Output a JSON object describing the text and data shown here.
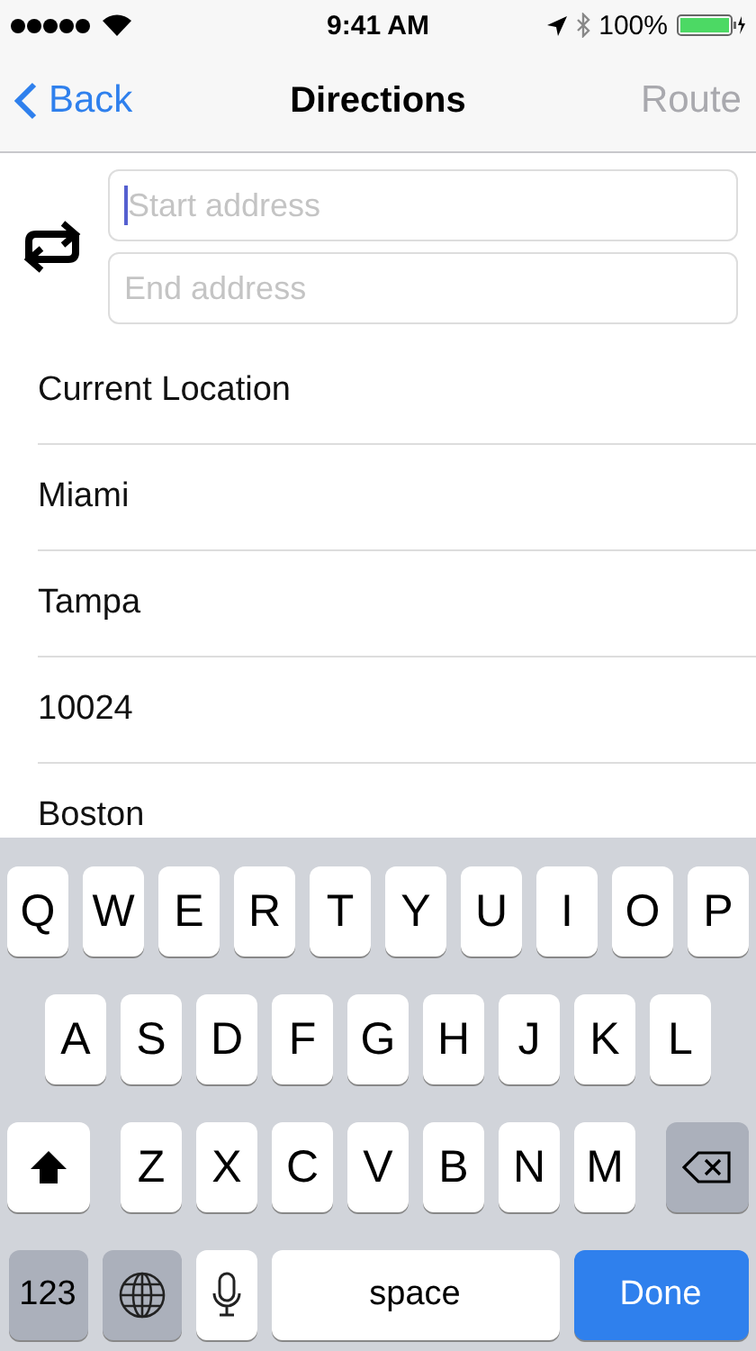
{
  "status_bar": {
    "time": "9:41 AM",
    "battery": "100%"
  },
  "nav_bar": {
    "back": "Back",
    "title": "Directions",
    "action": {
      "label": "Route",
      "disabled": true
    }
  },
  "fields": [
    {
      "placeholder": "Start address",
      "focused": true
    },
    {
      "placeholder": "End address",
      "focused": false
    }
  ],
  "suggestions": [
    "Current Location",
    "Miami",
    "Tampa",
    "10024",
    "Boston"
  ],
  "keyboard": {
    "rows": [
      {
        "keys": [
          {
            "kind": "letter",
            "label": "Q"
          },
          {
            "kind": "letter",
            "label": "W"
          },
          {
            "kind": "letter",
            "label": "E"
          },
          {
            "kind": "letter",
            "label": "R"
          },
          {
            "kind": "letter",
            "label": "T"
          },
          {
            "kind": "letter",
            "label": "Y"
          },
          {
            "kind": "letter",
            "label": "U"
          },
          {
            "kind": "letter",
            "label": "I"
          },
          {
            "kind": "letter",
            "label": "O"
          },
          {
            "kind": "letter",
            "label": "P"
          }
        ]
      },
      {
        "keys": [
          {
            "kind": "letter",
            "label": "A"
          },
          {
            "kind": "letter",
            "label": "S"
          },
          {
            "kind": "letter",
            "label": "D"
          },
          {
            "kind": "letter",
            "label": "F"
          },
          {
            "kind": "letter",
            "label": "G"
          },
          {
            "kind": "letter",
            "label": "H"
          },
          {
            "kind": "letter",
            "label": "J"
          },
          {
            "kind": "letter",
            "label": "K"
          },
          {
            "kind": "letter",
            "label": "L"
          }
        ]
      },
      {
        "keys": [
          {
            "kind": "shift"
          },
          {
            "kind": "letter",
            "label": "Z"
          },
          {
            "kind": "letter",
            "label": "X"
          },
          {
            "kind": "letter",
            "label": "C"
          },
          {
            "kind": "letter",
            "label": "V"
          },
          {
            "kind": "letter",
            "label": "B"
          },
          {
            "kind": "letter",
            "label": "N"
          },
          {
            "kind": "letter",
            "label": "M"
          },
          {
            "kind": "delete"
          }
        ]
      },
      {
        "keys": [
          {
            "kind": "numbers",
            "label": "123"
          },
          {
            "kind": "globe"
          },
          {
            "kind": "mic"
          },
          {
            "kind": "space",
            "label": "space"
          },
          {
            "kind": "done",
            "label": "Done"
          }
        ]
      }
    ]
  }
}
